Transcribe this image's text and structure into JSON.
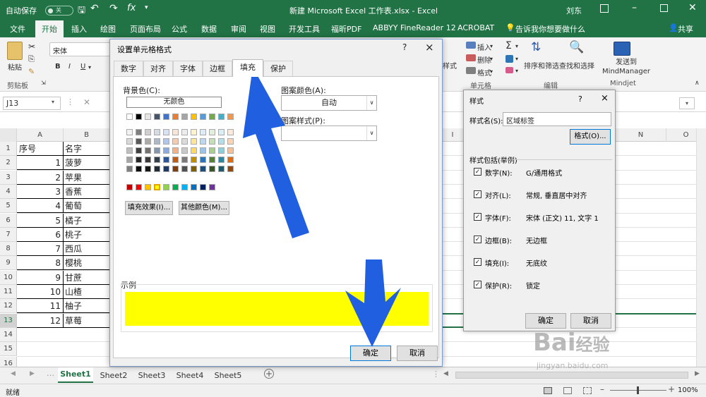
{
  "title_bar": {
    "autosave": "自动保存",
    "toggle": "关",
    "file_title": "新建 Microsoft Excel 工作表.xlsx - Excel",
    "user": "刘东"
  },
  "ribbon_tabs": [
    "文件",
    "开始",
    "插入",
    "绘图",
    "页面布局",
    "公式",
    "数据",
    "审阅",
    "视图",
    "开发工具",
    "福昕PDF",
    "ABBYY FineReader 12",
    "ACROBAT"
  ],
  "active_tab": "开始",
  "tell_me": "告诉我你想要做什么",
  "share": "共享",
  "ribbon": {
    "paste": "粘贴",
    "clipboard": "剪贴板",
    "font_name": "宋体",
    "insert": "插入",
    "delete": "删除",
    "format": "格式",
    "cells": "单元格",
    "sort_filter": "排序和筛选",
    "find_select": "查找和选择",
    "editing": "编辑",
    "send_mindmanager": "发送到 MindManager",
    "mindjet": "Mindjet",
    "style_partial": "样式"
  },
  "name_box": "J13",
  "columns": [
    "A",
    "B",
    "N",
    "O"
  ],
  "sheet": {
    "headers": [
      "序号",
      "名字"
    ],
    "rows": [
      [
        1,
        "菠萝"
      ],
      [
        2,
        "苹果"
      ],
      [
        3,
        "香蕉"
      ],
      [
        4,
        "葡萄"
      ],
      [
        5,
        "橘子"
      ],
      [
        6,
        "桃子"
      ],
      [
        7,
        "西瓜"
      ],
      [
        8,
        "樱桃"
      ],
      [
        9,
        "甘蔗"
      ],
      [
        10,
        "山楂"
      ],
      [
        11,
        "柚子"
      ],
      [
        12,
        "草莓"
      ]
    ],
    "row_numbers": [
      1,
      2,
      3,
      4,
      5,
      6,
      7,
      8,
      9,
      10,
      11,
      12,
      13,
      14,
      15,
      16
    ],
    "i_col": "I"
  },
  "sheet_tabs": [
    "Sheet1",
    "Sheet2",
    "Sheet3",
    "Sheet4",
    "Sheet5"
  ],
  "active_sheet": "Sheet1",
  "status": {
    "ready": "就绪",
    "zoom": "100%"
  },
  "format_dialog": {
    "title": "设置单元格格式",
    "tabs": [
      "数字",
      "对齐",
      "字体",
      "边框",
      "填充",
      "保护"
    ],
    "active_tab": "填充",
    "bg_color_label": "背景色(C):",
    "no_color": "无颜色",
    "pattern_color_label": "图案颜色(A):",
    "pattern_color_value": "自动",
    "pattern_style_label": "图案样式(P):",
    "fill_effects": "填充效果(I)...",
    "more_colors": "其他颜色(M)...",
    "sample_label": "示例",
    "sample_color": "#ffff00",
    "ok": "确定",
    "cancel": "取消",
    "help": "?",
    "close": "×",
    "theme_row": [
      "#ffffff",
      "#000000",
      "#e7e6e6",
      "#44546a",
      "#4472c4",
      "#ed7d31",
      "#a5a5a5",
      "#ffc000",
      "#5b9bd5",
      "#70ad47",
      "#4bacc6",
      "#f79646"
    ],
    "shades": [
      [
        "#f2f2f2",
        "#808080",
        "#d0cece",
        "#d6dce4",
        "#d9e2f3",
        "#fbe5d6",
        "#ededed",
        "#fff2cc",
        "#ddebf7",
        "#e2efd9",
        "#daeef3",
        "#fde9d9"
      ],
      [
        "#d9d9d9",
        "#595959",
        "#aeaaaa",
        "#adb9ca",
        "#b4c6e7",
        "#f8cbad",
        "#dbdbdb",
        "#ffe699",
        "#bdd7ee",
        "#c5e0b3",
        "#b6dde8",
        "#fbd4b4"
      ],
      [
        "#bfbfbf",
        "#404040",
        "#757171",
        "#8497b0",
        "#8eaadb",
        "#f4b183",
        "#c9c9c9",
        "#ffd966",
        "#9dc3e6",
        "#a8d08d",
        "#92cddc",
        "#fac08f"
      ],
      [
        "#a6a6a6",
        "#262626",
        "#3a3838",
        "#323f4f",
        "#2f5496",
        "#c55a11",
        "#7b7b7b",
        "#bf8f00",
        "#2e75b5",
        "#538135",
        "#31849b",
        "#e36c09"
      ],
      [
        "#808080",
        "#0d0d0d",
        "#171616",
        "#222a35",
        "#1f3864",
        "#833c0b",
        "#525252",
        "#7f6000",
        "#1f4e79",
        "#375623",
        "#215968",
        "#974806"
      ]
    ],
    "standard": [
      "#c00000",
      "#ff0000",
      "#ffc000",
      "#ffff00",
      "#92d050",
      "#00b050",
      "#00b0f0",
      "#0070c0",
      "#002060",
      "#7030a0"
    ]
  },
  "style_dialog": {
    "title": "样式",
    "help": "?",
    "close": "×",
    "name_label": "样式名(S):",
    "name_value": "区域标签",
    "format_btn": "格式(O)...",
    "includes": "样式包括(举例)",
    "items": [
      {
        "label": "数字(N):",
        "value": "G/通用格式"
      },
      {
        "label": "对齐(L):",
        "value": "常规, 垂直居中对齐"
      },
      {
        "label": "字体(F):",
        "value": "宋体 (正文) 11, 文字 1"
      },
      {
        "label": "边框(B):",
        "value": "无边框"
      },
      {
        "label": "填充(I):",
        "value": "无底纹"
      },
      {
        "label": "保护(R):",
        "value": "锁定"
      }
    ],
    "ok": "确定",
    "cancel": "取消"
  },
  "watermark": {
    "brand": "Bai",
    "brand2": "经验",
    "url": "jingyan.baidu.com"
  },
  "colors": {
    "excel_green": "#217346",
    "arrow_blue": "#1f5fe0"
  }
}
